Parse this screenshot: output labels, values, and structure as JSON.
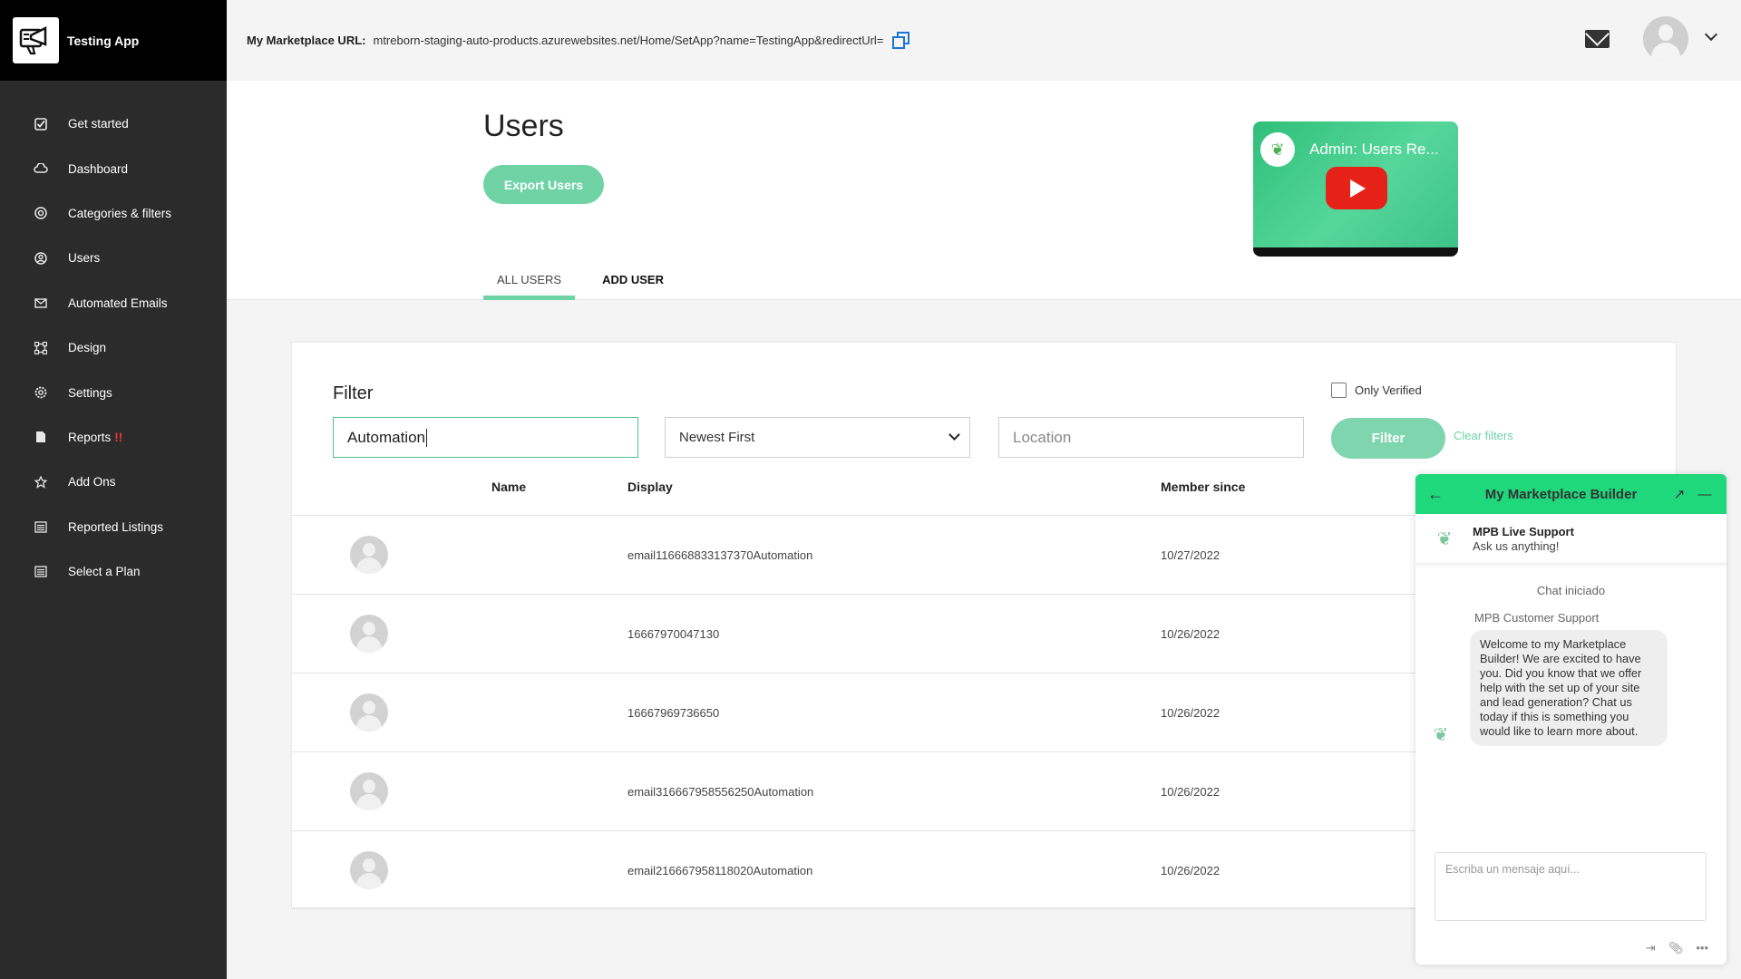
{
  "app": {
    "name": "Testing App"
  },
  "sidebar": {
    "items": [
      {
        "label": "Get started",
        "icon": "check-square-icon"
      },
      {
        "label": "Dashboard",
        "icon": "cloud-icon"
      },
      {
        "label": "Categories & filters",
        "icon": "target-icon"
      },
      {
        "label": "Users",
        "icon": "user-circle-icon"
      },
      {
        "label": "Automated Emails",
        "icon": "envelope-icon"
      },
      {
        "label": "Design",
        "icon": "vector-square-icon"
      },
      {
        "label": "Settings",
        "icon": "gear-icon"
      },
      {
        "label": "Reports",
        "icon": "file-icon",
        "alert": "!!"
      },
      {
        "label": "Add Ons",
        "icon": "star-icon"
      },
      {
        "label": "Reported Listings",
        "icon": "list-icon"
      },
      {
        "label": "Select a Plan",
        "icon": "list-icon"
      }
    ]
  },
  "topbar": {
    "url_label": "My Marketplace URL:",
    "url_value": "mtreborn-staging-auto-products.azurewebsites.net/Home/SetApp?name=TestingApp&redirectUrl="
  },
  "header": {
    "title": "Users",
    "export_label": "Export Users",
    "video_title": "Admin: Users Re...",
    "tabs": [
      {
        "label": "ALL USERS",
        "active": true
      },
      {
        "label": "ADD USER",
        "active": false
      }
    ]
  },
  "filter": {
    "title": "Filter",
    "only_verified_label": "Only Verified",
    "search_value": "Automation",
    "sort_value": "Newest First",
    "location_placeholder": "Location",
    "filter_button": "Filter",
    "clear_label": "Clear filters"
  },
  "table": {
    "columns": {
      "name": "Name",
      "display": "Display",
      "member_since": "Member since"
    },
    "rows": [
      {
        "display": "email116668833137370Automation",
        "member_since": "10/27/2022"
      },
      {
        "display": "16667970047130",
        "member_since": "10/26/2022"
      },
      {
        "display": "16667969736650",
        "member_since": "10/26/2022"
      },
      {
        "display": "email316667958556250Automation",
        "member_since": "10/26/2022"
      },
      {
        "display": "email216667958118020Automation",
        "member_since": "10/26/2022"
      }
    ]
  },
  "chat": {
    "title": "My Marketplace Builder",
    "agent_name": "MPB Live Support",
    "agent_subtitle": "Ask us anything!",
    "started_label": "Chat iniciado",
    "from_label": "MPB Customer Support",
    "message": "Welcome to my Marketplace Builder! We are excited to have you. Did you know that we offer help with the set up of your site and lead generation? Chat us today if this is something you would like to learn more about.",
    "input_placeholder": "Escriba un mensaje aquí..."
  },
  "colors": {
    "accent": "#6fd3a6",
    "chat_header": "#1ed87b",
    "sidebar_bg": "#2b2b2b",
    "link_blue": "#1976d2",
    "alert_red": "#e53935"
  }
}
